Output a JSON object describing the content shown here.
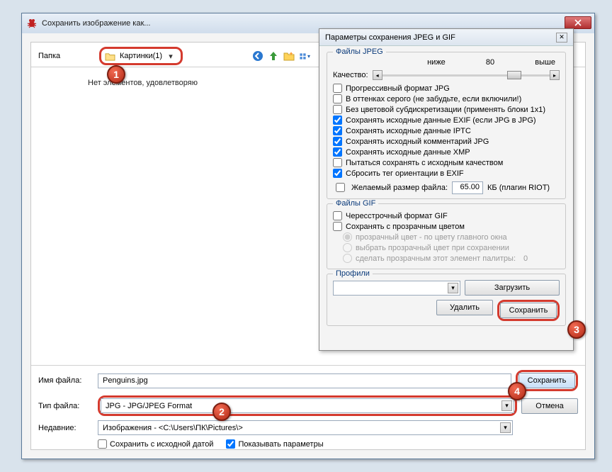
{
  "window": {
    "title": "Сохранить изображение как..."
  },
  "folderRow": {
    "label": "Папка",
    "folder": "Картинки(1)"
  },
  "empty": "Нет элементов, удовлетворяю",
  "fileRow": {
    "label": "Имя файла:",
    "value": "Penguins.jpg"
  },
  "typeRow": {
    "label": "Тип файла:",
    "value": "JPG - JPG/JPEG Format"
  },
  "recentRow": {
    "label": "Недавние:",
    "value": "Изображения  -  <C:\\Users\\ПК\\Pictures\\>"
  },
  "save_btn": "Сохранить",
  "cancel_btn": "Отмена",
  "origdate": "Сохранить с исходной датой",
  "showparams": "Показывать параметры",
  "panel": {
    "title": "Параметры сохранения JPEG и GIF",
    "jpeg": {
      "group": "Файлы JPEG",
      "lower": "ниже",
      "val": "80",
      "higher": "выше",
      "quality": "Качество:",
      "o1": "Прогрессивный формат JPG",
      "o2": "В оттенках серого (не забудьте, если включили!)",
      "o3": "Без цветовой субдискретизации (применять блоки 1x1)",
      "o4": "Сохранять исходные данные EXIF (если JPG в JPG)",
      "o5": "Сохранять исходные данные IPTC",
      "o6": "Сохранять исходный комментарий JPG",
      "o7": "Сохранять исходные данные XMP",
      "o8": "Пытаться сохранять с исходным качеством",
      "o9": "Сбросить тег ориентации в EXIF",
      "sizelbl": "Желаемый размер файла:",
      "sizeval": "65.00",
      "sizeunit": "КБ (плагин RIOT)"
    },
    "gif": {
      "group": "Файлы GIF",
      "o1": "Чересстрочный формат GIF",
      "o2": "Сохранять с прозрачным цветом",
      "r1": "прозрачный цвет - по цвету главного окна",
      "r2": "выбрать прозрачный цвет при сохранении",
      "r3": "сделать прозрачным этот элемент палитры:",
      "r3val": "0"
    },
    "profiles": {
      "group": "Профили",
      "load": "Загрузить",
      "del": "Удалить",
      "save": "Сохранить"
    }
  },
  "markers": {
    "m1": "1",
    "m2": "2",
    "m3": "3",
    "m4": "4"
  }
}
